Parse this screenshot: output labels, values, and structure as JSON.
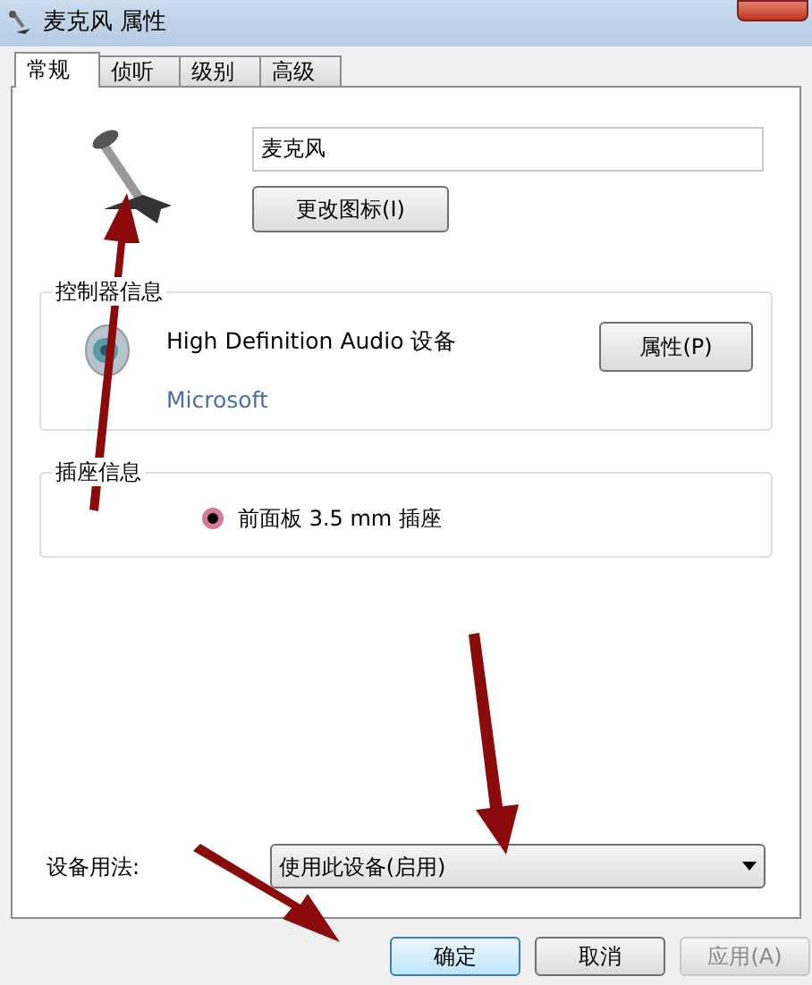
{
  "window": {
    "title": "麦克风 属性"
  },
  "tabs": [
    {
      "label": "常规",
      "selected": true
    },
    {
      "label": "侦听",
      "selected": false
    },
    {
      "label": "级别",
      "selected": false
    },
    {
      "label": "高级",
      "selected": false
    }
  ],
  "name_field": {
    "value": "麦克风"
  },
  "change_icon_button": "更改图标(I)",
  "controller": {
    "title": "控制器信息",
    "device": "High Definition Audio 设备",
    "manufacturer": "Microsoft",
    "properties_button": "属性(P)"
  },
  "jack": {
    "title": "插座信息",
    "jacks": [
      {
        "label": "前面板 3.5 mm 插座",
        "color": "#d87898"
      }
    ]
  },
  "usage": {
    "label": "设备用法:",
    "value": "使用此设备(启用)"
  },
  "buttons": [
    {
      "label": "确定",
      "disabled": false,
      "default": true
    },
    {
      "label": "取消",
      "disabled": false,
      "default": false
    },
    {
      "label": "应用(A)",
      "disabled": true,
      "default": false
    }
  ]
}
